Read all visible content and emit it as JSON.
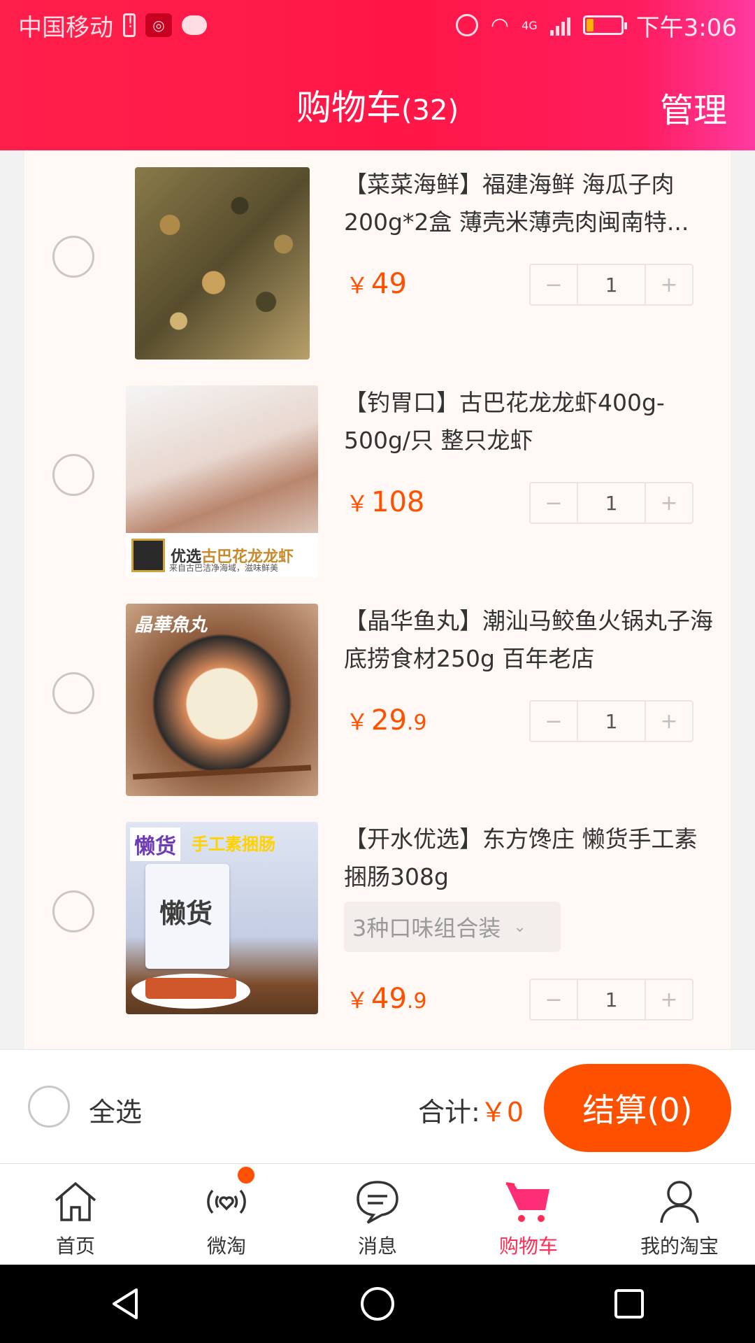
{
  "status_bar": {
    "carrier": "中国移动",
    "network": "4G",
    "time": "下午3:06",
    "colors": {
      "battery_fill": "#ffb300"
    }
  },
  "header": {
    "title": "购物车",
    "count": "(32)",
    "manage_label": "管理"
  },
  "items": [
    {
      "title": "【菜菜海鲜】福建海鲜 海瓜子肉200g*2盒 薄壳米薄壳肉闽南特...",
      "price_int": "49",
      "price_dec": "",
      "currency": "￥",
      "quantity": "1",
      "minus": "−",
      "plus": "+"
    },
    {
      "title": "【钓胃口】古巴花龙龙虾400g-500g/只 整只龙虾",
      "price_int": "108",
      "price_dec": "",
      "currency": "￥",
      "quantity": "1",
      "minus": "−",
      "plus": "+",
      "image_text": {
        "main_a": "优选",
        "main_b": "古巴花龙龙虾",
        "sub": "来自古巴洁净海域，滋味鲜美"
      }
    },
    {
      "title": "【晶华鱼丸】潮汕马鲛鱼火锅丸子海底捞食材250g 百年老店",
      "price_int": "29",
      "price_dec": ".9",
      "currency": "￥",
      "quantity": "1",
      "minus": "−",
      "plus": "+",
      "image_text": {
        "brand": "晶華魚丸"
      }
    },
    {
      "title": "【开水优选】东方馋庄 懒货手工素捆肠308g",
      "sku": "3种口味组合装",
      "price_int": "49",
      "price_dec": ".9",
      "currency": "￥",
      "quantity": "1",
      "minus": "−",
      "plus": "+",
      "image_text": {
        "tag": "懒货",
        "tag2": "手工素捆肠",
        "pack": "懒货"
      }
    }
  ],
  "bottom": {
    "select_all": "全选",
    "total_label": "合计:",
    "total_amount": "￥0",
    "checkout": "结算(0)",
    "colors": {
      "accent": "#ff5000"
    }
  },
  "tabs": [
    {
      "label": "首页",
      "icon": "home-icon"
    },
    {
      "label": "微淘",
      "icon": "weitao-icon"
    },
    {
      "label": "消息",
      "icon": "message-icon"
    },
    {
      "label": "购物车",
      "icon": "cart-icon",
      "active": true
    },
    {
      "label": "我的淘宝",
      "icon": "profile-icon"
    }
  ]
}
